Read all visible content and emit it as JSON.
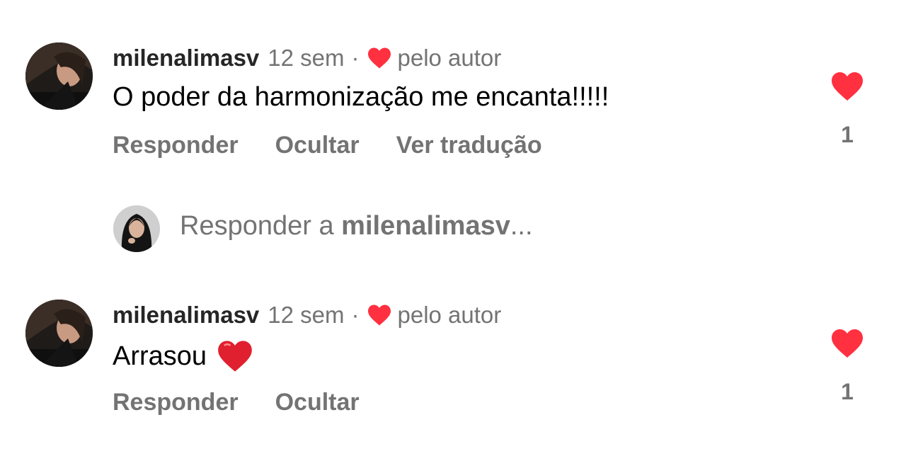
{
  "comments": [
    {
      "username": "milenalimasv",
      "time": "12 sem",
      "separator": "·",
      "author_like_label": "pelo autor",
      "text": "O poder da harmonização me encanta!!!!!",
      "has_heart_emoji": false,
      "actions": [
        "Responder",
        "Ocultar",
        "Ver tradução"
      ],
      "like_count": "1"
    },
    {
      "username": "milenalimasv",
      "time": "12 sem",
      "separator": "·",
      "author_like_label": "pelo autor",
      "text": "Arrasou",
      "has_heart_emoji": true,
      "actions": [
        "Responder",
        "Ocultar"
      ],
      "like_count": "1"
    }
  ],
  "reply_input": {
    "prefix": "Responder a",
    "target": "milenalimasv",
    "suffix": "..."
  },
  "colors": {
    "heart": "#ff3040",
    "muted_text": "#737373",
    "username": "#262626"
  },
  "icons": {
    "like": "heart-icon",
    "author_like": "heart-icon"
  }
}
